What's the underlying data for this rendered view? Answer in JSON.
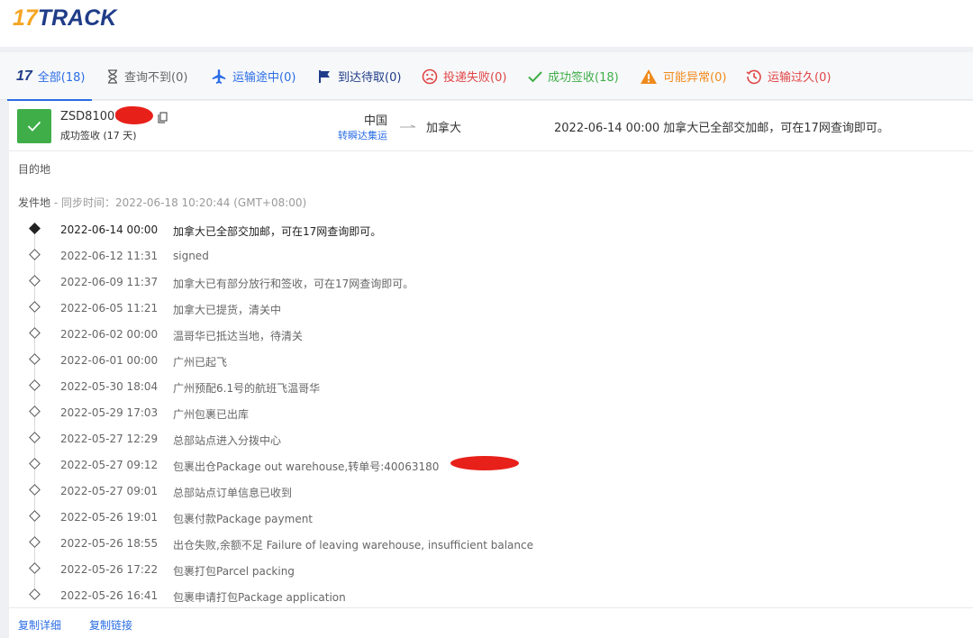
{
  "logo": {
    "num": "17",
    "word": "TRACK"
  },
  "colors": {
    "accent": "#2b6de5",
    "success": "#3fae49",
    "danger": "#e04545",
    "warning": "#f08a1c",
    "brand_orange": "#f5a623",
    "brand_navy": "#1f3c88"
  },
  "tabs": [
    {
      "label": "全部(18)",
      "icon": "17-logo-icon",
      "color": "#2b6de5"
    },
    {
      "label": "查询不到(0)",
      "icon": "hourglass-icon",
      "color": "#666666"
    },
    {
      "label": "运输途中(0)",
      "icon": "airplane-icon",
      "color": "#2b6de5"
    },
    {
      "label": "到达待取(0)",
      "icon": "flag-icon",
      "color": "#1f3c88"
    },
    {
      "label": "投递失败(0)",
      "icon": "sad-face-icon",
      "color": "#e04545"
    },
    {
      "label": "成功签收(18)",
      "icon": "checkmark-icon",
      "color": "#3fae49"
    },
    {
      "label": "可能异常(0)",
      "icon": "warning-icon",
      "color": "#f08a1c"
    },
    {
      "label": "运输过久(0)",
      "icon": "clock-history-icon",
      "color": "#e04545"
    }
  ],
  "shipment": {
    "tracking_number": "ZSD81000",
    "status": "成功签收 (17 天)",
    "origin": "中国",
    "origin_sub": "转瞬达集运",
    "destination": "加拿大",
    "latest_event": "2022-06-14 00:00  加拿大已全部交加邮，可在17网查询即可。"
  },
  "sections": {
    "destination_label": "目的地",
    "origin_label": "发件地",
    "sync_text": " - 同步时间：2022-06-18 10:20:44 (GMT+08:00)"
  },
  "events": [
    {
      "time": "2022-06-14 00:00",
      "desc": "加拿大已全部交加邮，可在17网查询即可。"
    },
    {
      "time": "2022-06-12 11:31",
      "desc": "signed"
    },
    {
      "time": "2022-06-09 11:37",
      "desc": "加拿大已有部分放行和签收，可在17网查询即可。"
    },
    {
      "time": "2022-06-05 11:21",
      "desc": "加拿大已提货，清关中"
    },
    {
      "time": "2022-06-02 00:00",
      "desc": "温哥华已抵达当地，待清关"
    },
    {
      "time": "2022-06-01 00:00",
      "desc": "广州已起飞"
    },
    {
      "time": "2022-05-30 18:04",
      "desc": "广州预配6.1号的航班飞温哥华"
    },
    {
      "time": "2022-05-29 17:03",
      "desc": "广州包裹已出库"
    },
    {
      "time": "2022-05-27 12:29",
      "desc": "总部站点进入分拨中心"
    },
    {
      "time": "2022-05-27 09:12",
      "desc": "包裹出仓Package out warehouse,转单号:40063180"
    },
    {
      "time": "2022-05-27 09:01",
      "desc": "总部站点订单信息已收到"
    },
    {
      "time": "2022-05-26 19:01",
      "desc": "包裹付款Package payment"
    },
    {
      "time": "2022-05-26 18:55",
      "desc": "出仓失败,余额不足 Failure of leaving warehouse, insufficient balance"
    },
    {
      "time": "2022-05-26 17:22",
      "desc": "包裹打包Parcel packing"
    },
    {
      "time": "2022-05-26 16:41",
      "desc": "包裹申请打包Package application"
    }
  ],
  "footer": {
    "copy_details": "复制详细",
    "copy_link": "复制链接"
  }
}
